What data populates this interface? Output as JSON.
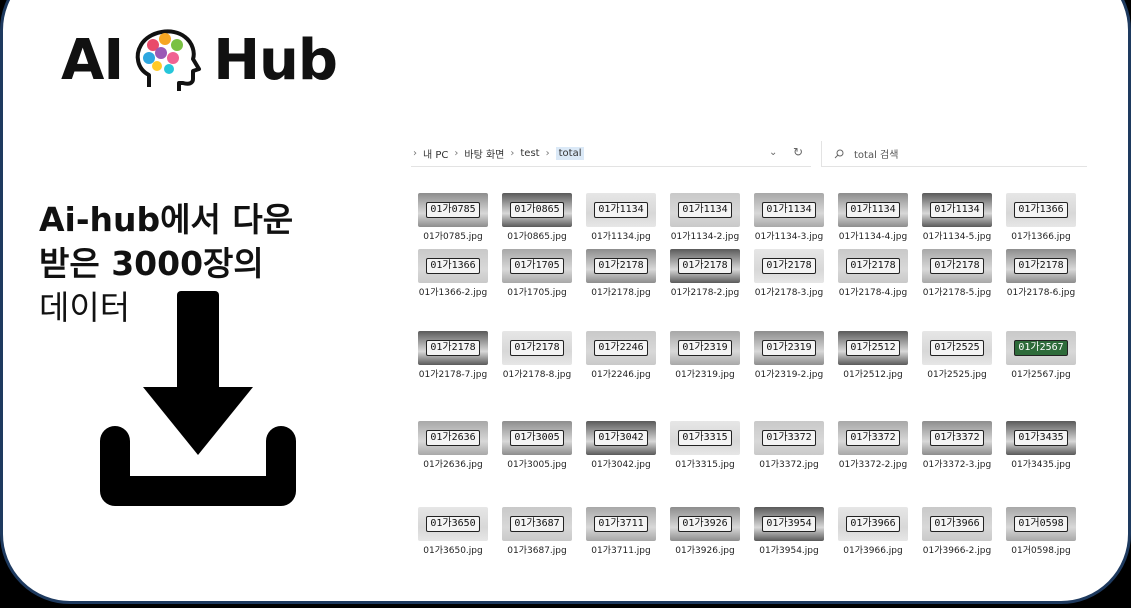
{
  "logo": {
    "left": "AI",
    "right": "Hub"
  },
  "caption": {
    "line1": "Ai-hub에서 다운",
    "line2": "받은 3000장의",
    "line3": "데이터"
  },
  "explorer": {
    "breadcrumb": [
      "내 PC",
      "바탕 화면",
      "test",
      "total"
    ],
    "search_placeholder": "total 검색"
  },
  "files": [
    {
      "name": "01가0785.jpg",
      "plate": "01가0785"
    },
    {
      "name": "01가0865.jpg",
      "plate": "01가0865"
    },
    {
      "name": "01가1134.jpg",
      "plate": "01가1134"
    },
    {
      "name": "01가1134-2.jpg",
      "plate": "01가1134"
    },
    {
      "name": "01가1134-3.jpg",
      "plate": "01가1134"
    },
    {
      "name": "01가1134-4.jpg",
      "plate": "01가1134"
    },
    {
      "name": "01가1134-5.jpg",
      "plate": "01가1134"
    },
    {
      "name": "01가1366.jpg",
      "plate": "01가1366"
    },
    {
      "name": "01가1366-2.jpg",
      "plate": "01가1366"
    },
    {
      "name": "01가1705.jpg",
      "plate": "01가1705"
    },
    {
      "name": "01가2178.jpg",
      "plate": "01가2178"
    },
    {
      "name": "01가2178-2.jpg",
      "plate": "01가2178"
    },
    {
      "name": "01가2178-3.jpg",
      "plate": "01가2178"
    },
    {
      "name": "01가2178-4.jpg",
      "plate": "01가2178"
    },
    {
      "name": "01가2178-5.jpg",
      "plate": "01가2178"
    },
    {
      "name": "01가2178-6.jpg",
      "plate": "01가2178"
    },
    {
      "name": "01가2178-7.jpg",
      "plate": "01가2178"
    },
    {
      "name": "01가2178-8.jpg",
      "plate": "01가2178"
    },
    {
      "name": "01가2246.jpg",
      "plate": "01가2246"
    },
    {
      "name": "01가2319.jpg",
      "plate": "01가2319"
    },
    {
      "name": "01가2319-2.jpg",
      "plate": "01가2319"
    },
    {
      "name": "01가2512.jpg",
      "plate": "01가2512"
    },
    {
      "name": "01가2525.jpg",
      "plate": "01가2525"
    },
    {
      "name": "01가2567.jpg",
      "plate": "01가2567"
    },
    {
      "name": "01가2636.jpg",
      "plate": "01가2636"
    },
    {
      "name": "01가3005.jpg",
      "plate": "01가3005"
    },
    {
      "name": "01가3042.jpg",
      "plate": "01가3042"
    },
    {
      "name": "01가3315.jpg",
      "plate": "01가3315"
    },
    {
      "name": "01가3372.jpg",
      "plate": "01가3372"
    },
    {
      "name": "01가3372-2.jpg",
      "plate": "01가3372"
    },
    {
      "name": "01가3372-3.jpg",
      "plate": "01가3372"
    },
    {
      "name": "01가3435.jpg",
      "plate": "01가3435"
    },
    {
      "name": "01가3650.jpg",
      "plate": "01가3650"
    },
    {
      "name": "01가3687.jpg",
      "plate": "01가3687"
    },
    {
      "name": "01가3711.jpg",
      "plate": "01가3711"
    },
    {
      "name": "01가3926.jpg",
      "plate": "01가3926"
    },
    {
      "name": "01가3954.jpg",
      "plate": "01가3954"
    },
    {
      "name": "01가3966.jpg",
      "plate": "01가3966"
    },
    {
      "name": "01가3966-2.jpg",
      "plate": "01가3966"
    },
    {
      "name": "01거0598.jpg",
      "plate": "01거0598"
    }
  ],
  "colors": {
    "border": "#1e3a5f",
    "plate": "#f4f4f4",
    "plate_green": "#2e6b3a"
  }
}
